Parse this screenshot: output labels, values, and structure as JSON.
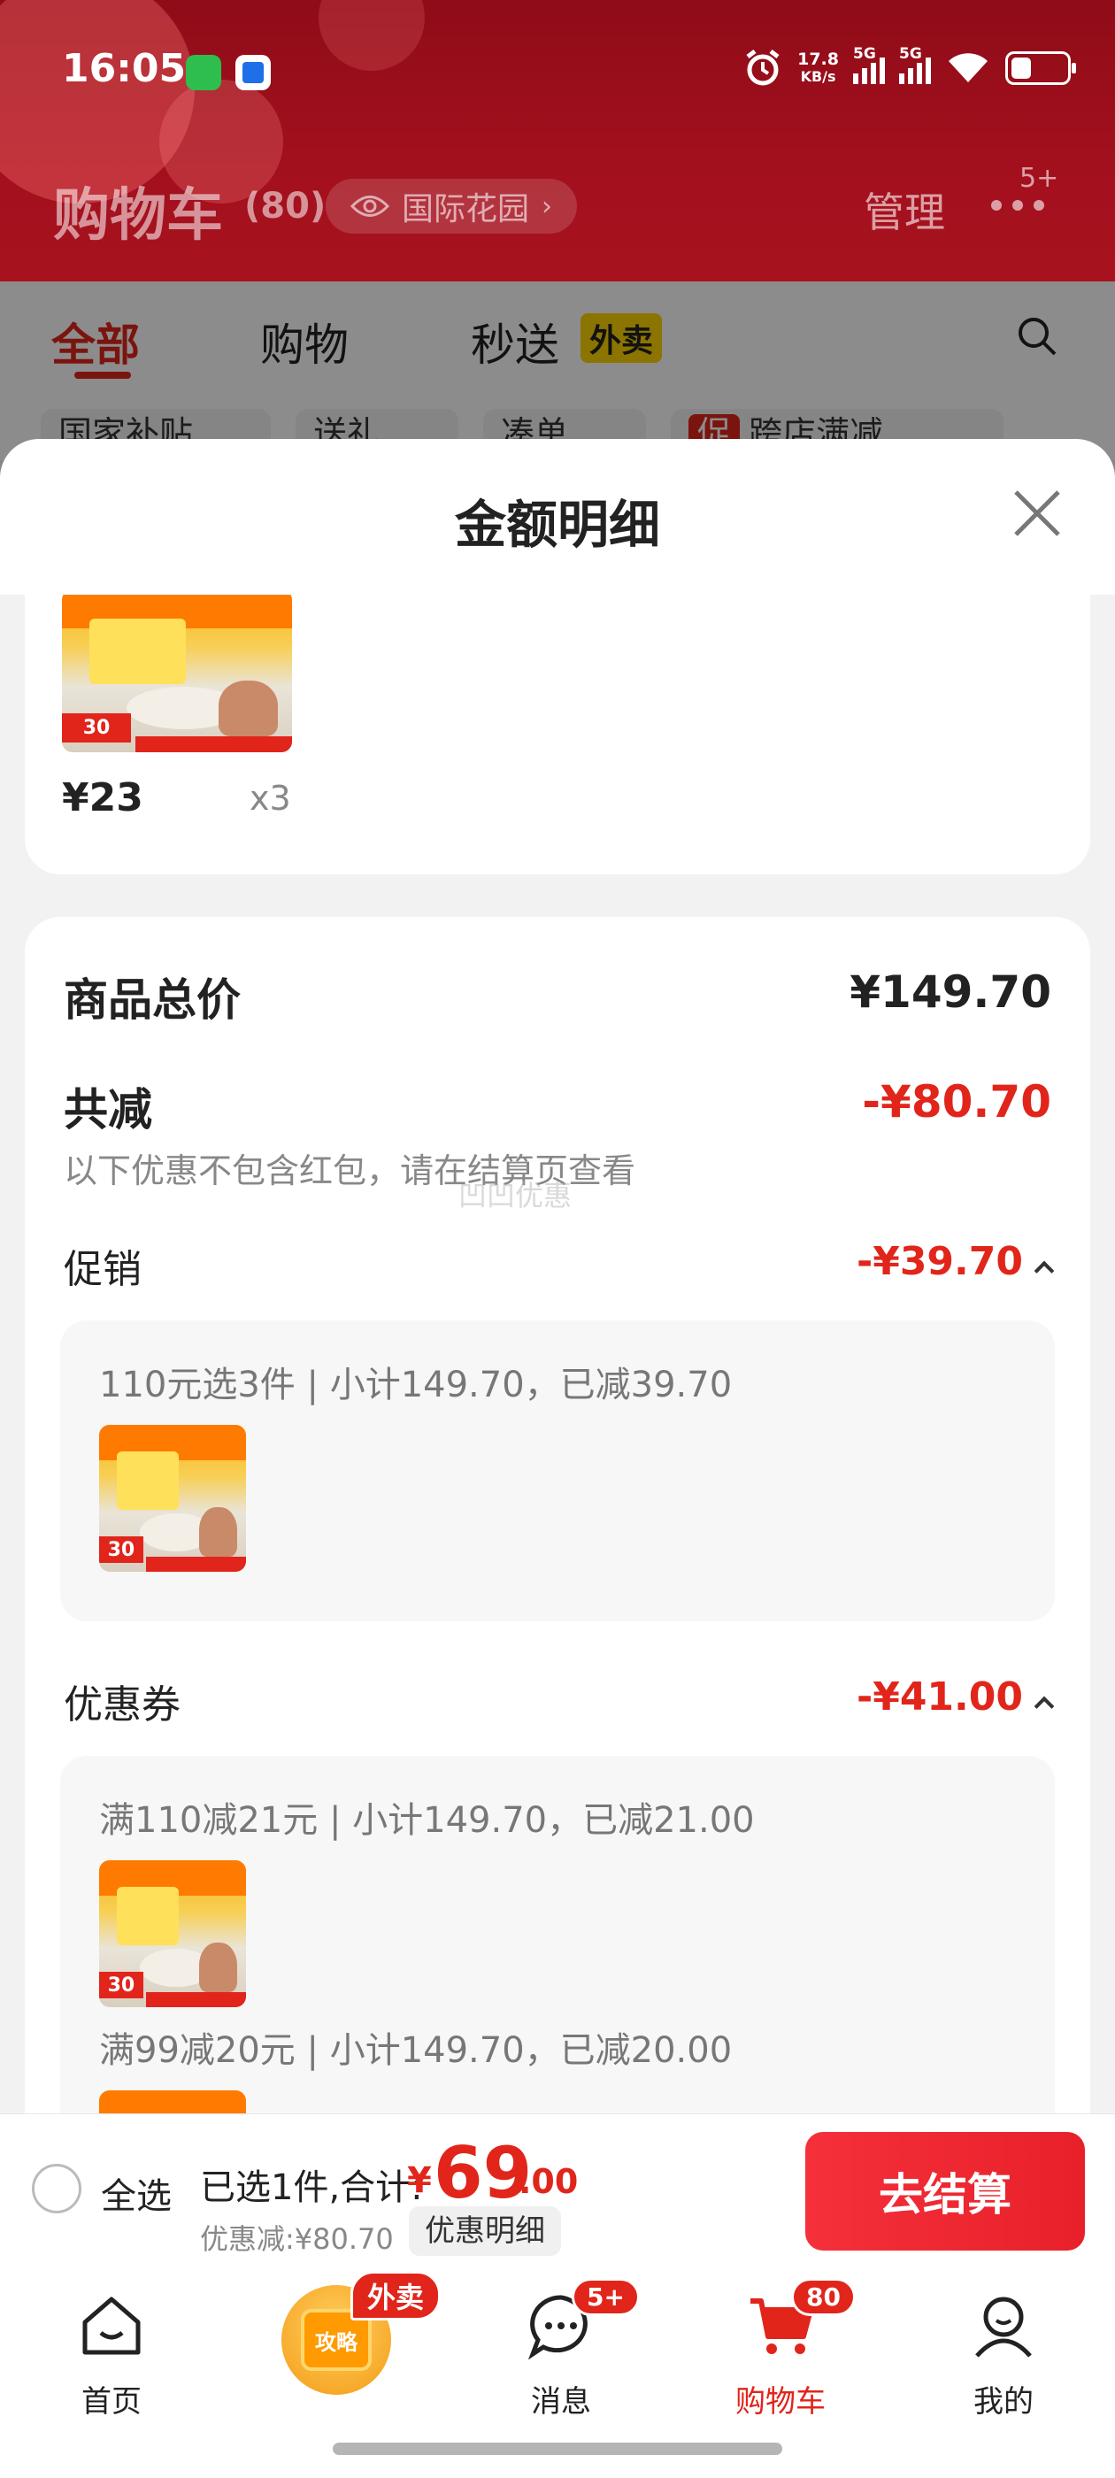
{
  "status_bar": {
    "time": "16:05",
    "net_speed_value": "17.8",
    "net_speed_unit": "KB/s",
    "signal1_label": "5G",
    "signal2_label": "5G"
  },
  "header": {
    "title": "购物车",
    "count": "(80)",
    "location": "国际花园",
    "manage": "管理",
    "more_badge": "5+"
  },
  "tabs": {
    "all": "全部",
    "shopping": "购物",
    "instant": "秒送",
    "instant_badge": "外卖"
  },
  "filter_chips": [
    "国家补贴",
    "送礼",
    "凑单",
    "跨店满减"
  ],
  "filter_chip_badge": "促",
  "sheet": {
    "title": "金额明细",
    "item": {
      "price": "¥23",
      "qty": "x3",
      "thumb_tag": "30"
    },
    "total_label": "商品总价",
    "total_value": "¥149.70",
    "reduce_label": "共减",
    "reduce_value": "-¥80.70",
    "note": "以下优惠不包含红包，请在结算页查看",
    "watermark": "凹凹优惠",
    "promo": {
      "label": "促销",
      "value": "-¥39.70",
      "line": "110元选3件 | 小计149.70，已减39.70"
    },
    "coupon": {
      "label": "优惠券",
      "value": "-¥41.00",
      "line1": "满110减21元 | 小计149.70，已减21.00",
      "line2": "满99减20元 | 小计149.70，已减20.00"
    }
  },
  "checkout": {
    "select_all": "全选",
    "selected_text": "已选1件,合计:",
    "currency": "¥",
    "amount_int": "69",
    "amount_dec": ".00",
    "discount": "优惠减:¥80.70",
    "detail_button": "优惠明细",
    "pay_button": "去结算"
  },
  "nav": {
    "home": "首页",
    "guide": "攻略",
    "guide_badge": "外卖",
    "messages": "消息",
    "messages_badge": "5+",
    "cart": "购物车",
    "cart_badge": "80",
    "mine": "我的"
  },
  "colors": {
    "brand_red": "#e1251b",
    "header_red": "#a3101d",
    "pay_button": "#f5303a"
  }
}
